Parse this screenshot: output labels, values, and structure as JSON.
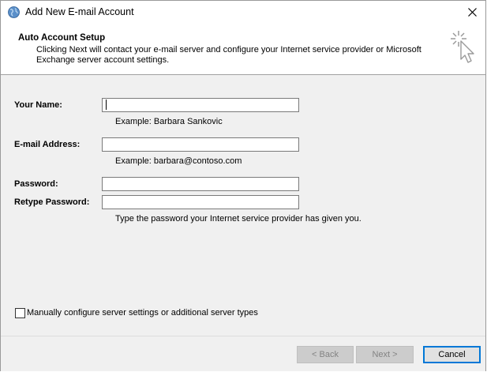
{
  "window": {
    "title": "Add New E-mail Account"
  },
  "header": {
    "title": "Auto Account Setup",
    "description": "Clicking Next will contact your e-mail server and configure your Internet service provider or Microsoft Exchange server account settings."
  },
  "form": {
    "name_label": "Your Name:",
    "name_value": "",
    "name_hint": "Example: Barbara Sankovic",
    "email_label": "E-mail Address:",
    "email_value": "",
    "email_hint": "Example: barbara@contoso.com",
    "password_label": "Password:",
    "password_value": "",
    "retype_label": "Retype Password:",
    "retype_value": "",
    "password_hint": "Type the password your Internet service provider has given you."
  },
  "options": {
    "manual_config_label": "Manually configure server settings or additional server types",
    "manual_config_checked": false
  },
  "footer": {
    "back_label": "< Back",
    "next_label": "Next >",
    "cancel_label": "Cancel"
  },
  "icons": {
    "app": "outlook-globe-icon",
    "close": "close-icon",
    "header": "cursor-click-icon"
  },
  "colors": {
    "accent": "#0078d7",
    "body_bg": "#f0f0f0"
  }
}
